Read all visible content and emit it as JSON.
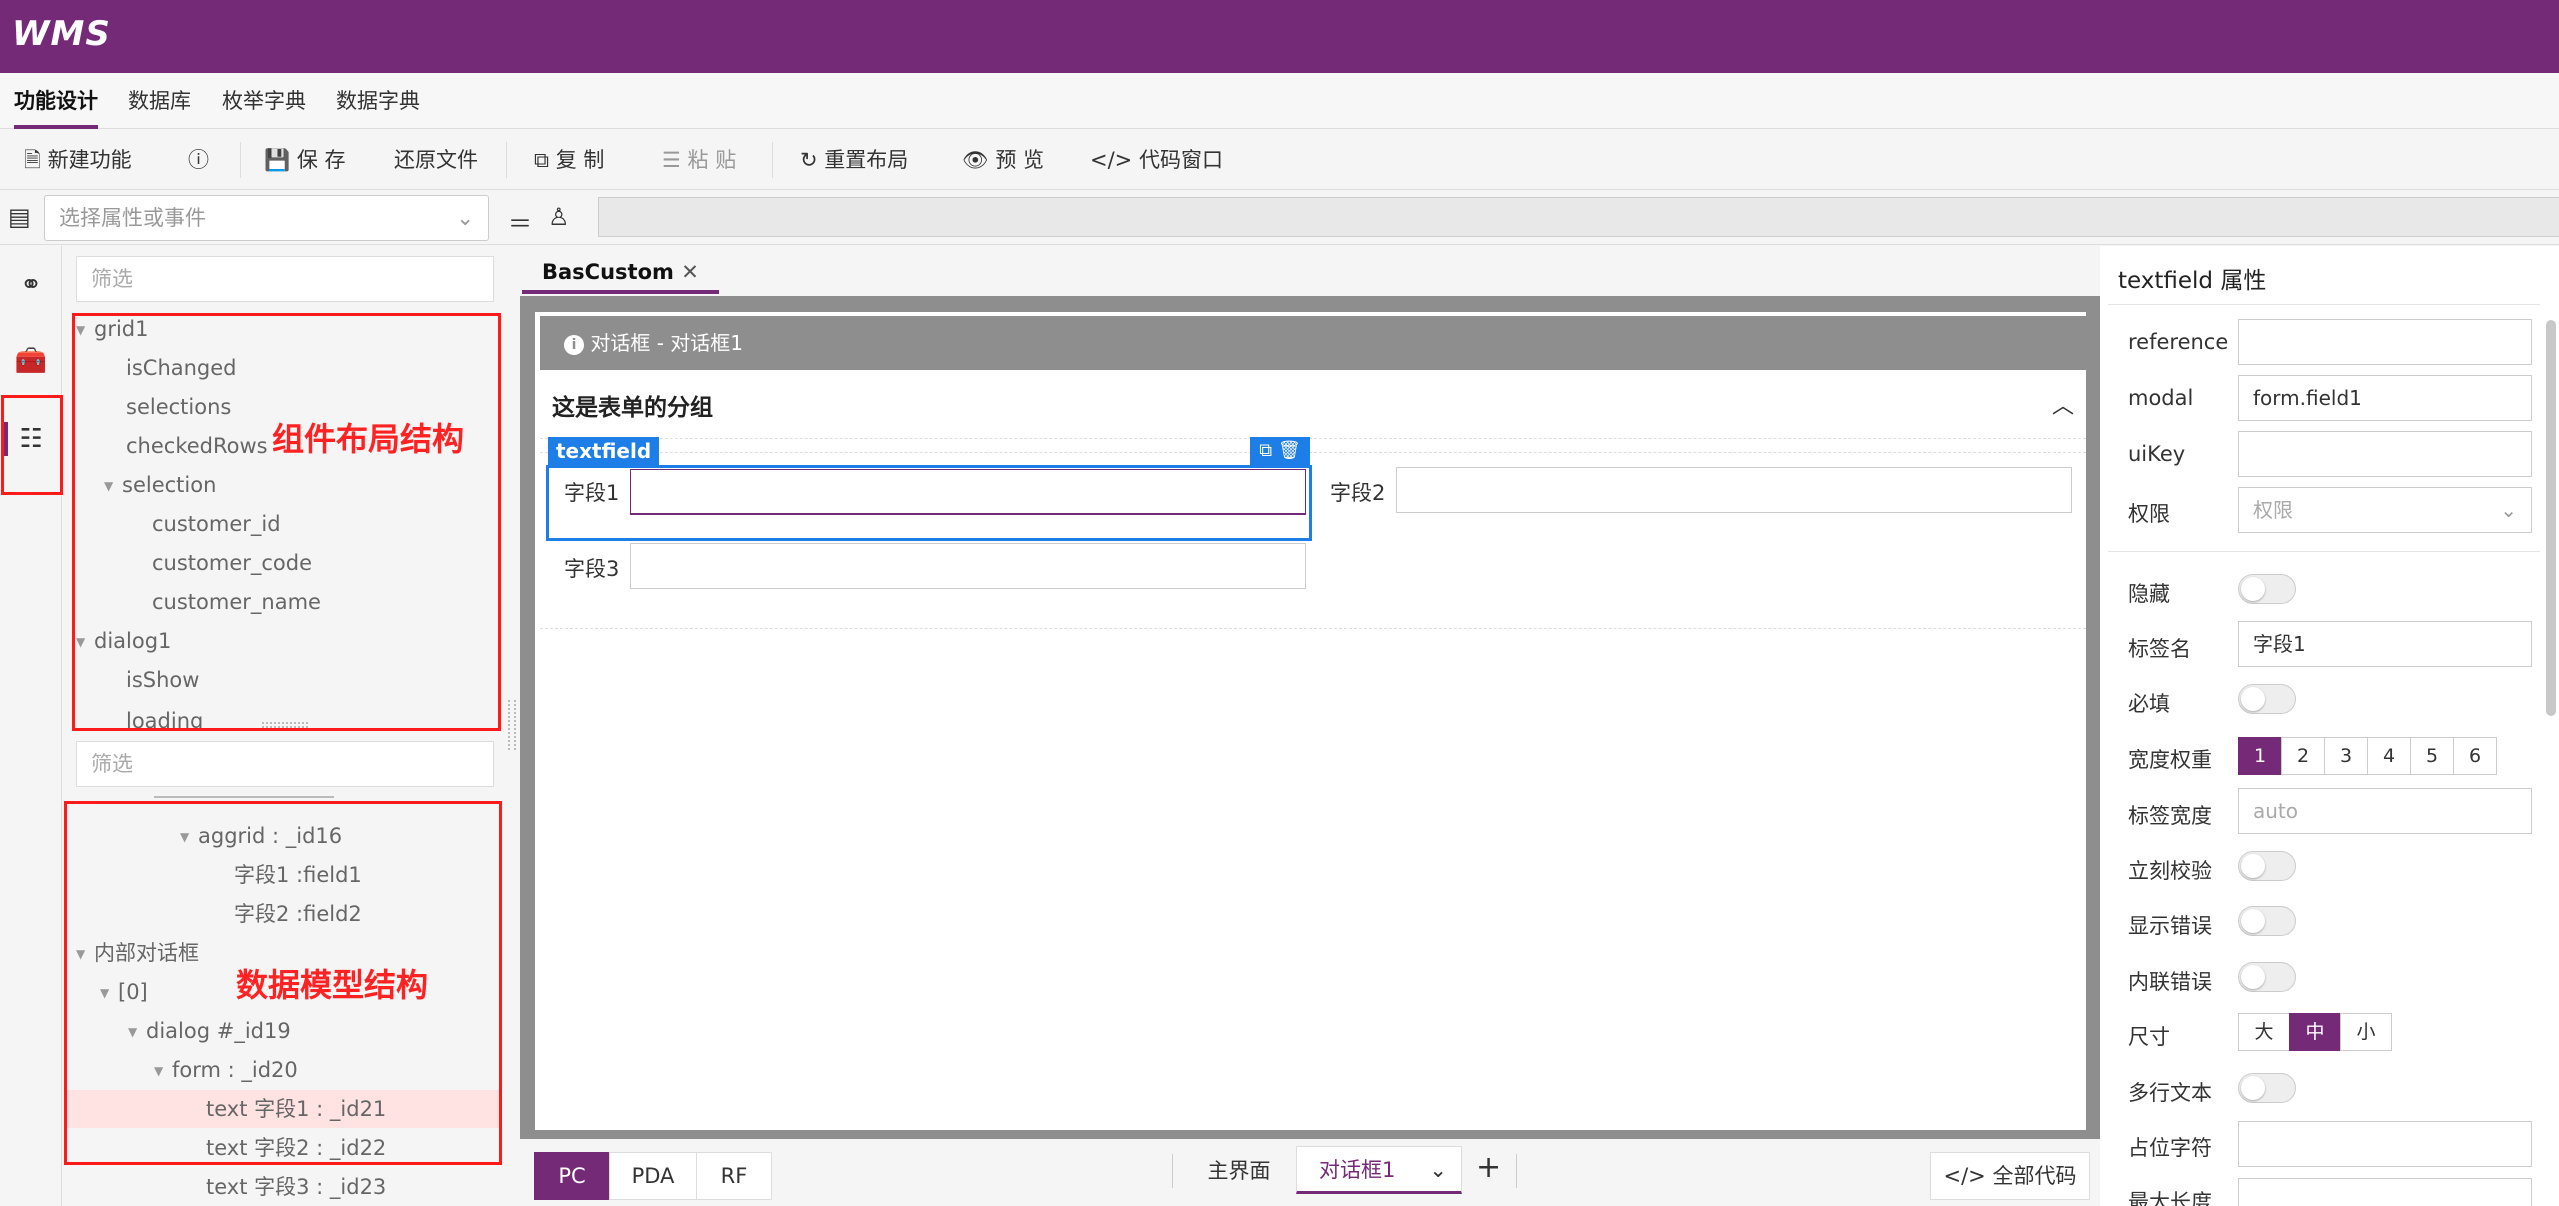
{
  "app": {
    "logo": "WMS"
  },
  "menu": {
    "items": [
      "功能设计",
      "数据库",
      "枚举字典",
      "数据字典"
    ]
  },
  "toolbar": {
    "new": "新建功能",
    "save": "保 存",
    "restore": "还原文件",
    "copy": "复 制",
    "paste": "粘 贴",
    "reset": "重置布局",
    "preview": "预 览",
    "code": "代码窗口"
  },
  "propbar": {
    "select_placeholder": "选择属性或事件"
  },
  "tree1": {
    "filter": "筛选",
    "items": [
      "grid1",
      "isChanged",
      "selections",
      "checkedRows",
      "selection",
      "customer_id",
      "customer_code",
      "customer_name",
      "dialog1",
      "isShow",
      "loading"
    ]
  },
  "tree2": {
    "filter": "筛选",
    "items": [
      "aggrid : _id16",
      "字段1 :field1",
      "字段2 :field2",
      "内部对话框",
      "[0]",
      "dialog #_id19",
      "form : _id20",
      "text 字段1 : _id21",
      "text 字段2 : _id22",
      "text 字段3 : _id23"
    ]
  },
  "annotations": {
    "layout": "组件布局结构",
    "model": "数据模型结构"
  },
  "editor": {
    "tab": "BasCustom",
    "dialog_title": "对话框 - 对话框1",
    "group_title": "这是表单的分组",
    "selected_tag": "textfield",
    "field1": "字段1",
    "field2": "字段2",
    "field3": "字段3"
  },
  "bottom": {
    "pc": "PC",
    "pda": "PDA",
    "rf": "RF",
    "main": "主界面",
    "dialog": "对话框1",
    "allcode": "全部代码"
  },
  "props": {
    "title": "textfield 属性",
    "reference": "reference",
    "modal": "modal",
    "modal_val": "form.field1",
    "uikey": "uiKey",
    "perm": "权限",
    "perm_ph": "权限",
    "hidden": "隐藏",
    "labelname": "标签名",
    "labelname_val": "字段1",
    "required": "必填",
    "weight": "宽度权重",
    "weights": [
      "1",
      "2",
      "3",
      "4",
      "5",
      "6"
    ],
    "labelwidth": "标签宽度",
    "labelwidth_ph": "auto",
    "instant": "立刻校验",
    "showerr": "显示错误",
    "inlineerr": "内联错误",
    "size": "尺寸",
    "sizes": [
      "大",
      "中",
      "小"
    ],
    "multiline": "多行文本",
    "placeholder": "占位字符",
    "maxlen": "最大长度"
  },
  "colors": {
    "brand": "#752a78",
    "highlight": "#ffe3e3",
    "select": "#1e7ee8",
    "annotation": "#ff1a1a"
  }
}
